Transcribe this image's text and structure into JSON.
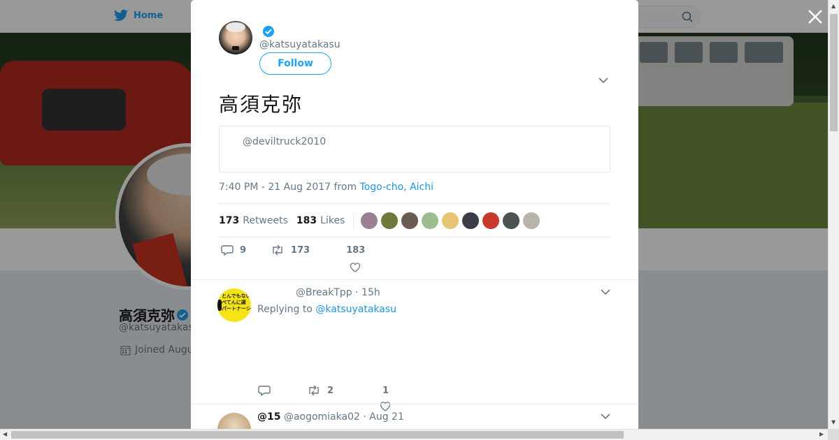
{
  "background": {
    "nav": {
      "home_label": "Home"
    },
    "profile": {
      "name": "高須克弥",
      "handle": "@katsuyatakasu",
      "joined": "Joined Augu"
    }
  },
  "modal": {
    "author": {
      "handle": "@katsuyatakasu",
      "verified": true
    },
    "follow_label": "Follow",
    "tweet_text": "高須克弥",
    "quoted": {
      "handle": "@deviltruck2010"
    },
    "meta": {
      "time": "7:40 PM - 21 Aug 2017",
      "from_word": "from",
      "location": "Togo-cho, Aichi"
    },
    "stats": {
      "retweets_count": "173",
      "retweets_label": "Retweets",
      "likes_count": "183",
      "likes_label": "Likes",
      "liker_colors": [
        "#9a7f93",
        "#6e7a3a",
        "#6b5a52",
        "#9bbd8f",
        "#e6c676",
        "#3a3d47",
        "#c63a2d",
        "#4b5250",
        "#b8b3a8"
      ]
    },
    "actions": {
      "replies": "9",
      "retweets": "173",
      "likes": "183"
    }
  },
  "replies": [
    {
      "handle": "@BreakTpp",
      "time": "15h",
      "avatar_text": [
        "とんでもない",
        "ぺてんに譲",
        "パートナーシ"
      ],
      "replying_prefix": "Replying to",
      "replying_to": "@katsuyatakasu",
      "actions": {
        "replies": "",
        "retweets": "2",
        "likes": "1"
      }
    },
    {
      "name": "@15",
      "handle": "@aogomiaka02",
      "time": "Aug 21"
    }
  ],
  "colors": {
    "accent": "#1da1f2",
    "link": "#1b95e0",
    "muted": "#657786"
  }
}
